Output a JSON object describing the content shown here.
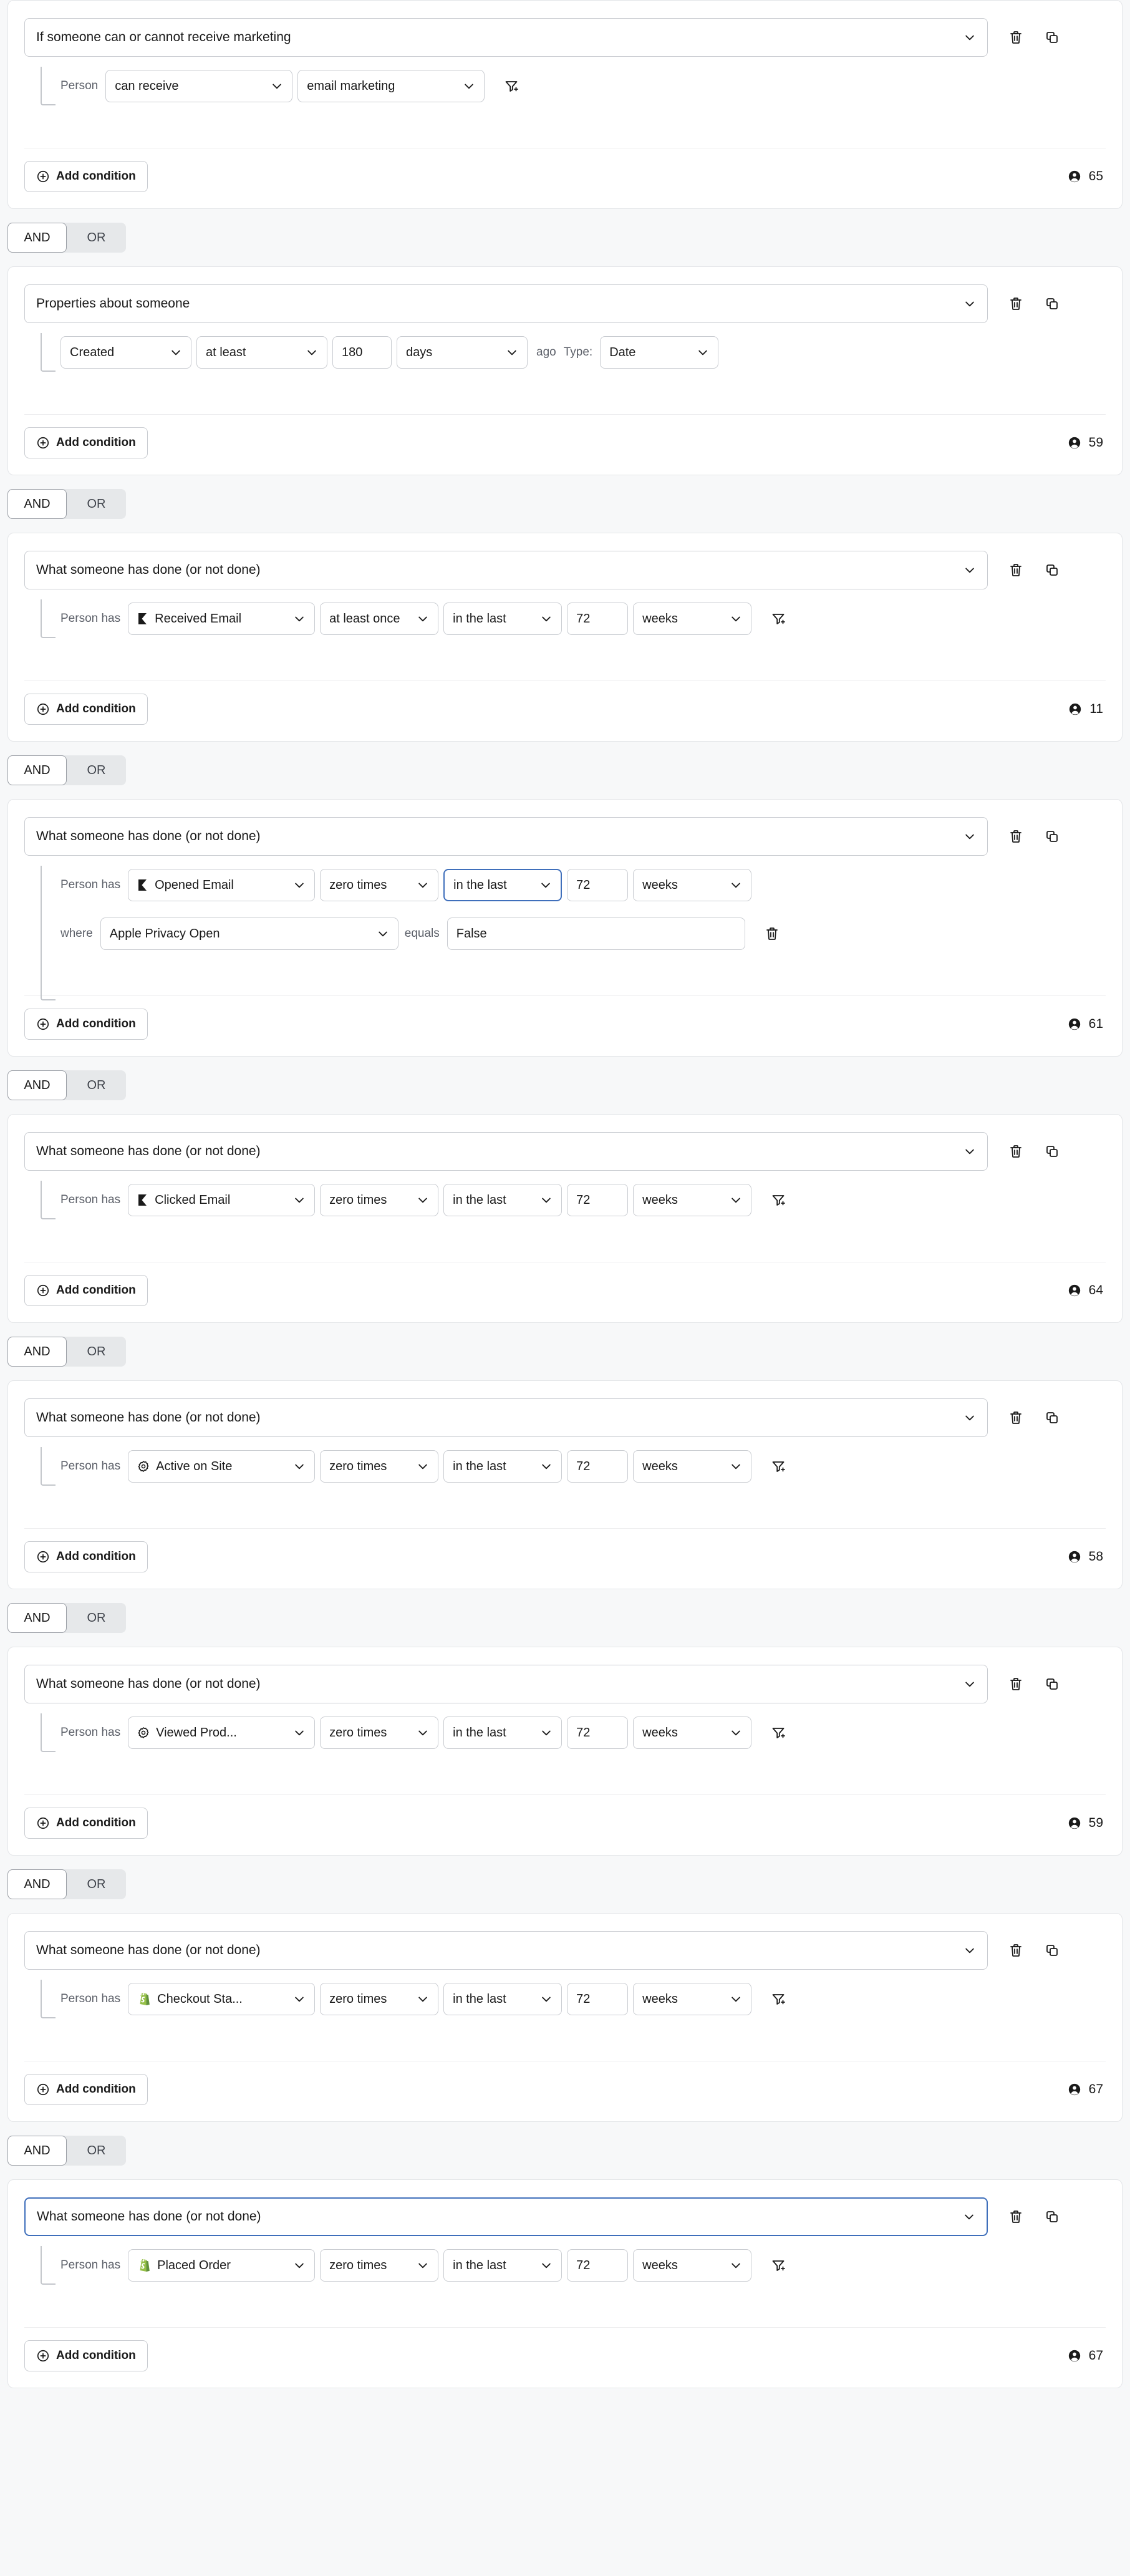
{
  "logic_toggle": {
    "and_label": "AND",
    "or_label": "OR",
    "selected": "AND"
  },
  "common": {
    "add_condition_label": "Add condition",
    "person_label": "Person",
    "person_has_label": "Person has",
    "where_label": "where",
    "equals_label": "equals",
    "ago_label": "ago",
    "type_label": "Type:",
    "delete_icon": "trash-icon",
    "duplicate_icon": "copy-icon",
    "filter_add_icon": "filter-plus-icon",
    "profile_icon": "person-icon",
    "plus_icon": "plus-circle-icon",
    "chevron_icon": "chevron-down-icon"
  },
  "colors": {
    "page_bg": "#f7f8f9",
    "card_bg": "#ffffff",
    "card_border": "#e3e5e8",
    "input_border": "#c9ccd1",
    "focus_border": "#3f6fbb",
    "muted_text": "#5c6069",
    "toggle_bg": "#e6e8ea",
    "shopify_green": "#95bf47",
    "klaviyo_black": "#1a1a1a"
  },
  "cards": [
    {
      "type": "marketing",
      "title": "If someone can or cannot receive marketing",
      "title_focused": false,
      "rows": [
        {
          "kind": "person",
          "label": "Person",
          "fields": [
            {
              "name": "consent-status-select",
              "value": "can receive",
              "width": "w-person"
            },
            {
              "name": "channel-select",
              "value": "email marketing",
              "width": "w-value"
            }
          ],
          "trailing": "filter-plus-icon"
        }
      ],
      "count": "65"
    },
    {
      "type": "properties",
      "title": "Properties about someone",
      "title_focused": false,
      "rows": [
        {
          "kind": "properties",
          "fields": [
            {
              "name": "property-select",
              "value": "Created",
              "width": "w-pa-op"
            },
            {
              "name": "comparison-select",
              "value": "at least",
              "width": "w-pa-cmp"
            },
            {
              "name": "amount-input",
              "value": "180",
              "width": "w-pa-num"
            },
            {
              "name": "unit-select",
              "value": "days",
              "width": "w-pa-unit"
            }
          ],
          "after_text": "ago",
          "type_label": "Type:",
          "type_value": "Date",
          "trailing": null
        }
      ],
      "count": "59"
    },
    {
      "type": "activity",
      "title": "What someone has done (or not done)",
      "title_focused": false,
      "rows": [
        {
          "kind": "activity",
          "label": "Person has",
          "fields": [
            {
              "name": "metric-select",
              "value": "Received Email",
              "icon": "klaviyo-icon",
              "width": "w-metric"
            },
            {
              "name": "frequency-select",
              "value": "at least once",
              "width": "w-count"
            },
            {
              "name": "timeframe-select",
              "value": "in the last",
              "width": "w-timeop"
            },
            {
              "name": "timeframe-amount-input",
              "value": "72",
              "width": "w-num"
            },
            {
              "name": "timeframe-unit-select",
              "value": "weeks",
              "width": "w-unit"
            }
          ],
          "trailing": "filter-plus-icon"
        }
      ],
      "count": "11"
    },
    {
      "type": "activity",
      "title": "What someone has done (or not done)",
      "title_focused": false,
      "rows": [
        {
          "kind": "activity",
          "label": "Person has",
          "fields": [
            {
              "name": "metric-select",
              "value": "Opened Email",
              "icon": "klaviyo-icon",
              "width": "w-metric"
            },
            {
              "name": "frequency-select",
              "value": "zero times",
              "width": "w-count"
            },
            {
              "name": "timeframe-select",
              "value": "in the last",
              "width": "w-timeop",
              "focused": true
            },
            {
              "name": "timeframe-amount-input",
              "value": "72",
              "width": "w-num"
            },
            {
              "name": "timeframe-unit-select",
              "value": "weeks",
              "width": "w-unit"
            }
          ],
          "trailing": null
        },
        {
          "kind": "where",
          "label": "where",
          "fields": [
            {
              "name": "dimension-select",
              "value": "Apple Privacy Open",
              "width": "w-prop"
            }
          ],
          "mid_text": "equals",
          "value_field": {
            "name": "dimension-value-input",
            "value": "False",
            "width": "w-equals"
          },
          "trailing": "trash-icon"
        }
      ],
      "count": "61"
    },
    {
      "type": "activity",
      "title": "What someone has done (or not done)",
      "title_focused": false,
      "rows": [
        {
          "kind": "activity",
          "label": "Person has",
          "fields": [
            {
              "name": "metric-select",
              "value": "Clicked Email",
              "icon": "klaviyo-icon",
              "width": "w-metric"
            },
            {
              "name": "frequency-select",
              "value": "zero times",
              "width": "w-count"
            },
            {
              "name": "timeframe-select",
              "value": "in the last",
              "width": "w-timeop"
            },
            {
              "name": "timeframe-amount-input",
              "value": "72",
              "width": "w-num"
            },
            {
              "name": "timeframe-unit-select",
              "value": "weeks",
              "width": "w-unit"
            }
          ],
          "trailing": "filter-plus-icon"
        }
      ],
      "count": "64"
    },
    {
      "type": "activity",
      "title": "What someone has done (or not done)",
      "title_focused": false,
      "rows": [
        {
          "kind": "activity",
          "label": "Person has",
          "fields": [
            {
              "name": "metric-select",
              "value": "Active on Site",
              "icon": "gear-icon",
              "width": "w-metric"
            },
            {
              "name": "frequency-select",
              "value": "zero times",
              "width": "w-count"
            },
            {
              "name": "timeframe-select",
              "value": "in the last",
              "width": "w-timeop"
            },
            {
              "name": "timeframe-amount-input",
              "value": "72",
              "width": "w-num"
            },
            {
              "name": "timeframe-unit-select",
              "value": "weeks",
              "width": "w-unit"
            }
          ],
          "trailing": "filter-plus-icon"
        }
      ],
      "count": "58"
    },
    {
      "type": "activity",
      "title": "What someone has done (or not done)",
      "title_focused": false,
      "rows": [
        {
          "kind": "activity",
          "label": "Person has",
          "fields": [
            {
              "name": "metric-select",
              "value": "Viewed Prod...",
              "icon": "gear-icon",
              "width": "w-metric"
            },
            {
              "name": "frequency-select",
              "value": "zero times",
              "width": "w-count"
            },
            {
              "name": "timeframe-select",
              "value": "in the last",
              "width": "w-timeop"
            },
            {
              "name": "timeframe-amount-input",
              "value": "72",
              "width": "w-num"
            },
            {
              "name": "timeframe-unit-select",
              "value": "weeks",
              "width": "w-unit"
            }
          ],
          "trailing": "filter-plus-icon"
        }
      ],
      "count": "59"
    },
    {
      "type": "activity",
      "title": "What someone has done (or not done)",
      "title_focused": false,
      "rows": [
        {
          "kind": "activity",
          "label": "Person has",
          "fields": [
            {
              "name": "metric-select",
              "value": "Checkout Sta...",
              "icon": "shopify-icon",
              "width": "w-metric"
            },
            {
              "name": "frequency-select",
              "value": "zero times",
              "width": "w-count"
            },
            {
              "name": "timeframe-select",
              "value": "in the last",
              "width": "w-timeop"
            },
            {
              "name": "timeframe-amount-input",
              "value": "72",
              "width": "w-num"
            },
            {
              "name": "timeframe-unit-select",
              "value": "weeks",
              "width": "w-unit"
            }
          ],
          "trailing": "filter-plus-icon"
        }
      ],
      "count": "67"
    },
    {
      "type": "activity",
      "title": "What someone has done (or not done)",
      "title_focused": true,
      "rows": [
        {
          "kind": "activity",
          "label": "Person has",
          "fields": [
            {
              "name": "metric-select",
              "value": "Placed Order",
              "icon": "shopify-icon",
              "width": "w-metric"
            },
            {
              "name": "frequency-select",
              "value": "zero times",
              "width": "w-count"
            },
            {
              "name": "timeframe-select",
              "value": "in the last",
              "width": "w-timeop"
            },
            {
              "name": "timeframe-amount-input",
              "value": "72",
              "width": "w-num"
            },
            {
              "name": "timeframe-unit-select",
              "value": "weeks",
              "width": "w-unit"
            }
          ],
          "trailing": "filter-plus-icon"
        }
      ],
      "count": "67"
    }
  ]
}
